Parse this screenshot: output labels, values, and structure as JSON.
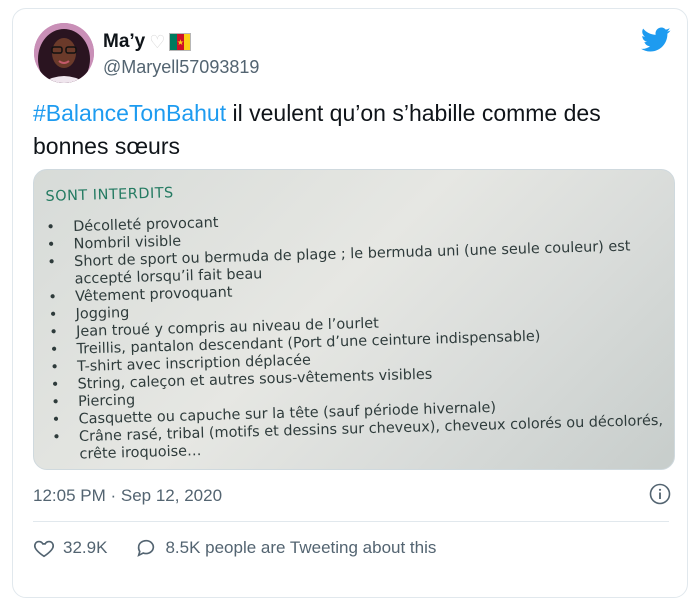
{
  "tweet": {
    "author": {
      "display_name": "Ma’y",
      "handle": "@Maryell57093819",
      "emoji_heart": "🤍",
      "flag": "Cameroon"
    },
    "text": {
      "hashtag": "#BalanceTonBahut",
      "body": " il veulent qu’on s’habille comme des bonnes sœurs"
    },
    "media": {
      "heading": "SONT INTERDITS",
      "items": [
        "Décolleté provocant",
        "Nombril visible",
        "Short de sport ou bermuda de plage ; le bermuda uni (une seule couleur) est accepté lorsqu’il fait beau",
        "Vêtement provoquant",
        "Jogging",
        "Jean troué y compris au niveau de l’ourlet",
        "Treillis, pantalon descendant (Port d’une ceinture indispensable)",
        "T-shirt avec inscription déplacée",
        "String, caleçon et autres sous-vêtements visibles",
        "Piercing",
        "Casquette ou capuche sur la tête (sauf période hivernale)",
        "Crâne rasé, tribal (motifs et dessins sur cheveux), cheveux colorés ou décolorés, crête iroquoise…"
      ]
    },
    "timestamp": "12:05 PM · Sep 12, 2020",
    "stats": {
      "likes": "32.9K",
      "replies_text": "8.5K people are Tweeting about this"
    }
  },
  "colors": {
    "accent": "#1d9bf0",
    "muted_text": "#536471",
    "sheet_title": "#247b62"
  }
}
